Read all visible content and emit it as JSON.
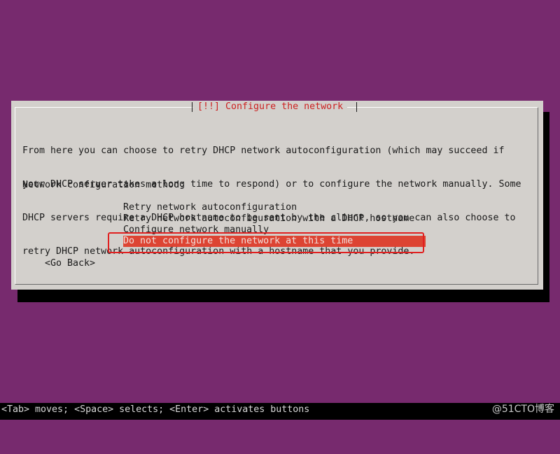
{
  "dialog": {
    "title": "[!!] Configure the network",
    "description_lines": [
      "From here you can choose to retry DHCP network autoconfiguration (which may succeed if",
      "your DHCP server takes a long time to respond) or to configure the network manually. Some",
      "DHCP servers require a DHCP hostname to be sent by the client, so you can also choose to",
      "retry DHCP network autoconfiguration with a hostname that you provide."
    ],
    "method_label": "Network configuration method:",
    "options": [
      {
        "label": "Retry network autoconfiguration"
      },
      {
        "label": "Retry network autoconfiguration with a DHCP hostname"
      },
      {
        "label": "Configure network manually"
      },
      {
        "label": "Do not configure the network at this time"
      }
    ],
    "selected_index": 3,
    "go_back_label": "<Go Back>"
  },
  "footer": {
    "hint": "<Tab> moves; <Space> selects; <Enter> activates buttons",
    "watermark": "@51CTO博客"
  },
  "colors": {
    "background": "#772a6e",
    "dialog": "#d3d0cc",
    "title_text": "#cc2222",
    "selection": "#dd4433",
    "annotation": "#e02020"
  }
}
